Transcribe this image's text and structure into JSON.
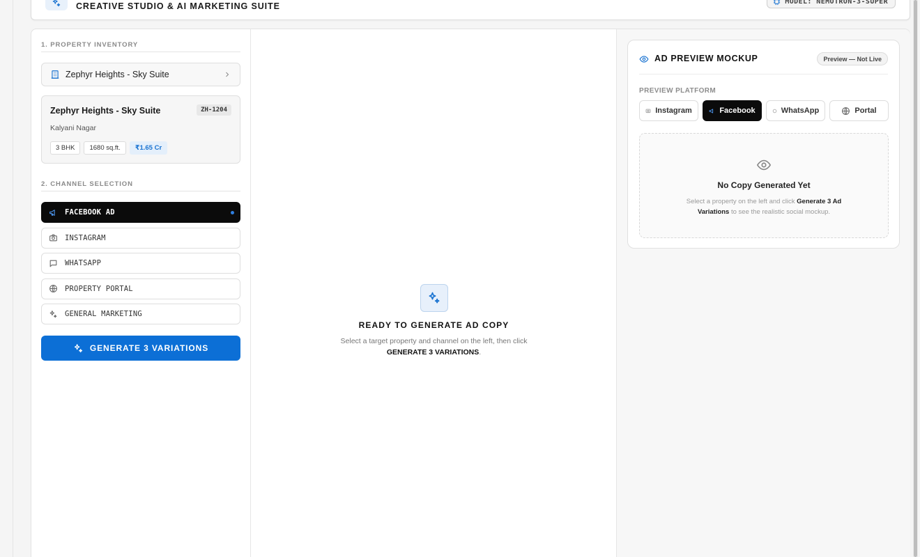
{
  "header": {
    "title": "CREATIVE STUDIO & AI MARKETING SUITE",
    "model_label": "MODEL: NEMOTRON-3-SUPER"
  },
  "inventory": {
    "section_label": "1. PROPERTY INVENTORY",
    "selected_property": "Zephyr Heights - Sky Suite",
    "card": {
      "name": "Zephyr Heights - Sky Suite",
      "code": "ZH-1204",
      "location": "Kalyani Nagar",
      "tags": [
        "3 BHK",
        "1680 sq.ft."
      ],
      "price": "₹1.65 Cr"
    }
  },
  "channels": {
    "section_label": "2. CHANNEL SELECTION",
    "items": [
      {
        "label": "FACEBOOK AD",
        "icon": "megaphone-icon",
        "active": true
      },
      {
        "label": "INSTAGRAM",
        "icon": "camera-icon",
        "active": false
      },
      {
        "label": "WHATSAPP",
        "icon": "message-icon",
        "active": false
      },
      {
        "label": "PROPERTY PORTAL",
        "icon": "globe-icon",
        "active": false
      },
      {
        "label": "GENERAL MARKETING",
        "icon": "sparkles-icon",
        "active": false
      }
    ]
  },
  "generate_button": {
    "label": "GENERATE 3 VARIATIONS"
  },
  "empty_state": {
    "title": "READY TO GENERATE AD COPY",
    "text_pre": "Select a target property and channel on the left, then click",
    "text_bold": "GENERATE 3 VARIATIONS",
    "text_post": "."
  },
  "preview": {
    "title": "AD PREVIEW MOCKUP",
    "badge": "Preview — Not Live",
    "platform_label": "PREVIEW PLATFORM",
    "platforms": [
      {
        "label": "Instagram",
        "active": false
      },
      {
        "label": "Facebook",
        "active": true
      },
      {
        "label": "WhatsApp",
        "active": false
      },
      {
        "label": "Portal",
        "active": false
      }
    ],
    "empty_title": "No Copy Generated Yet",
    "empty_pre": "Select a property on the left and click",
    "empty_bold": "Generate 3 Ad Variations",
    "empty_post": "to see the realistic social mockup."
  },
  "colors": {
    "accent": "#0c6fd6",
    "active_bg": "#0b0b0b",
    "price_text": "#1a73d1"
  }
}
